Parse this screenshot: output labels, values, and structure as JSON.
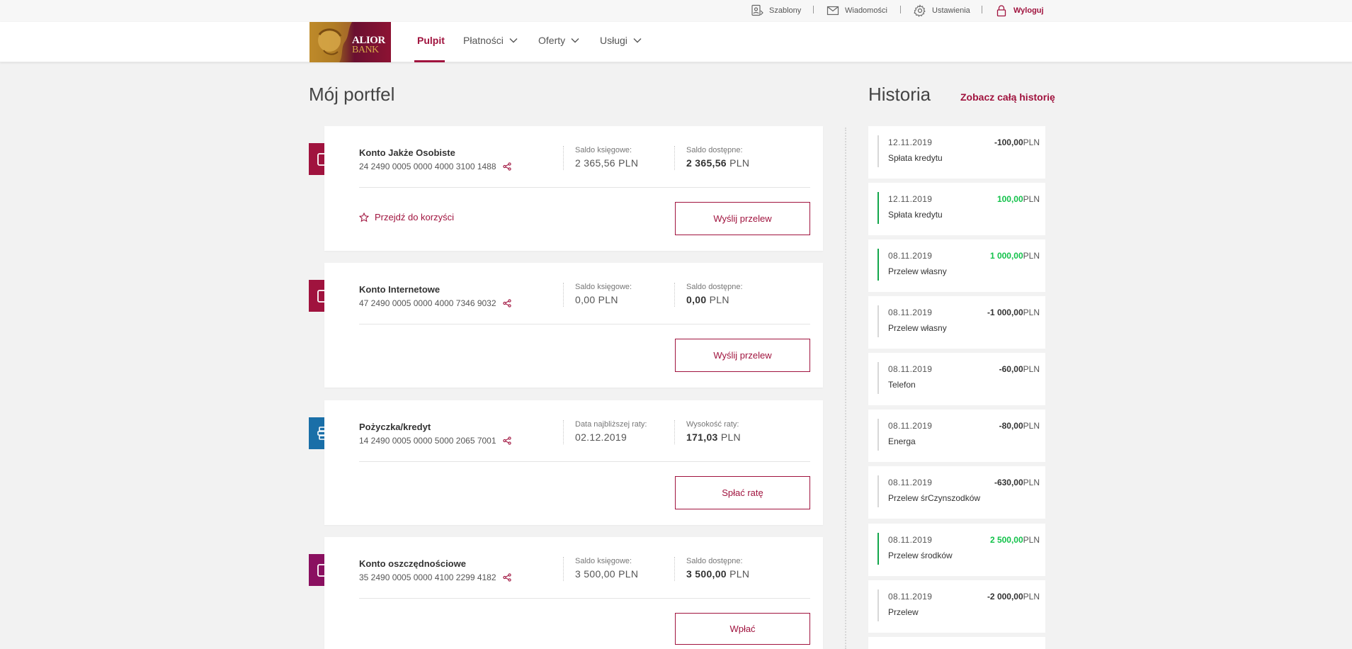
{
  "topbar": {
    "templates": "Szablony",
    "messages": "Wiadomości",
    "settings": "Ustawienia",
    "logout": "Wyloguj"
  },
  "logo": {
    "line1": "ALIOR",
    "line2": "BANK"
  },
  "nav": {
    "home": "Pulpit",
    "payments": "Płatności",
    "offers": "Oferty",
    "services": "Usługi"
  },
  "portfolio": {
    "title": "Mój portfel",
    "accounts": [
      {
        "name": "Konto Jakże Osobiste",
        "number": "24 2490 0005 0000 4000 3100 1488",
        "col1_label": "Saldo księgowe:",
        "col1_value": "2 365,56",
        "col2_label": "Saldo dostępne:",
        "col2_value": "2 365,56",
        "currency": "PLN",
        "benefit": "Przejdź do korzyści",
        "action": "Wyślij przelew",
        "icon_color": "#a0133e"
      },
      {
        "name": "Konto Internetowe",
        "number": "47 2490 0005 0000 4000 7346 9032",
        "col1_label": "Saldo księgowe:",
        "col1_value": "0,00",
        "col2_label": "Saldo dostępne:",
        "col2_value": "0,00",
        "currency": "PLN",
        "action": "Wyślij przelew",
        "icon_color": "#a0133e"
      },
      {
        "name": "Pożyczka/kredyt",
        "number": "14 2490 0005 0000 5000 2065 7001",
        "col1_label": "Data najbliższej raty:",
        "col1_value": "02.12.2019",
        "col2_label": "Wysokość raty:",
        "col2_value": "171,03",
        "currency": "PLN",
        "action": "Spłać ratę",
        "icon_color": "#1a6fa8"
      },
      {
        "name": "Konto oszczędnościowe",
        "number": "35 2490 0005 0000 4100 2299 4182",
        "col1_label": "Saldo księgowe:",
        "col1_value": "3 500,00",
        "col2_label": "Saldo dostępne:",
        "col2_value": "3 500,00",
        "currency": "PLN",
        "action": "Wpłać",
        "icon_color": "#8a1060"
      }
    ]
  },
  "history": {
    "title": "Historia",
    "link": "Zobacz całą historię",
    "currency": "PLN",
    "items": [
      {
        "date": "12.11.2019",
        "title": "Spłata kredytu",
        "amount": "-100,00",
        "positive": false
      },
      {
        "date": "12.11.2019",
        "title": "Spłata kredytu",
        "amount": "100,00",
        "positive": true
      },
      {
        "date": "08.11.2019",
        "title": "Przelew własny",
        "amount": "1 000,00",
        "positive": true
      },
      {
        "date": "08.11.2019",
        "title": "Przelew własny",
        "amount": "-1 000,00",
        "positive": false
      },
      {
        "date": "08.11.2019",
        "title": "Telefon",
        "amount": "-60,00",
        "positive": false
      },
      {
        "date": "08.11.2019",
        "title": "Energa",
        "amount": "-80,00",
        "positive": false
      },
      {
        "date": "08.11.2019",
        "title": "Przelew śrCzynszodków",
        "amount": "-630,00",
        "positive": false
      },
      {
        "date": "08.11.2019",
        "title": "Przelew środków",
        "amount": "2 500,00",
        "positive": true
      },
      {
        "date": "08.11.2019",
        "title": "Przelew",
        "amount": "-2 000,00",
        "positive": false
      }
    ]
  },
  "colors": {
    "brand": "#a0133e",
    "positive": "#12c24a",
    "loan": "#1a6fa8"
  }
}
